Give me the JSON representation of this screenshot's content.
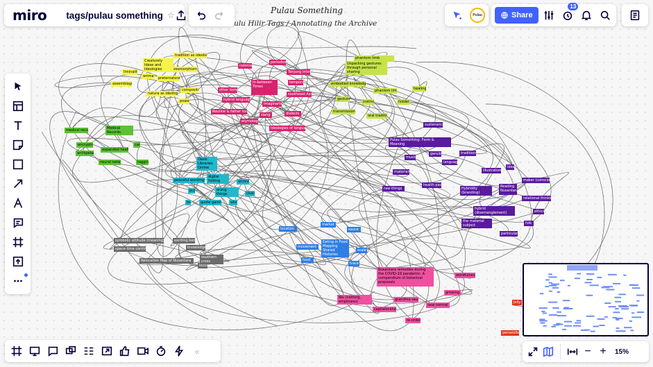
{
  "app": {
    "logo": "miro"
  },
  "header": {
    "board_title": "tags/pulau something",
    "share_label": "Share",
    "notification_count": "13",
    "avatar_text": "Pulau"
  },
  "canvas_titles": {
    "title_1": "Pulau Something",
    "title_2": "Pulu Hilir Tags / Annotating the Archive"
  },
  "notes": [
    {
      "text": "tradition as ideology",
      "bg": "#f5f34a",
      "fg": "#000"
    },
    {
      "text": "Creaturely Ideas and Ideologies",
      "bg": "#f5f34a",
      "fg": "#000"
    },
    {
      "text": "zoomorphism",
      "bg": "#f5f34a",
      "fg": "#000"
    },
    {
      "text": "liminality",
      "bg": "#f5f34a",
      "fg": "#000"
    },
    {
      "text": "animal",
      "bg": "#f5f34a",
      "fg": "#000"
    },
    {
      "text": "preternatural",
      "bg": "#f5f34a",
      "fg": "#000"
    },
    {
      "text": "assemblage",
      "bg": "#f5f34a",
      "fg": "#000"
    },
    {
      "text": "natura as ideology",
      "bg": "#f5f34a",
      "fg": "#000"
    },
    {
      "text": "composite",
      "bg": "#f5f34a",
      "fg": "#000"
    },
    {
      "text": "power",
      "bg": "#f5f34a",
      "fg": "#000"
    },
    {
      "text": "phantom limb",
      "bg": "#c6e34a",
      "fg": "#000"
    },
    {
      "text": "Unpacking gestures through personal sharing",
      "bg": "#c6e34a",
      "fg": "#000"
    },
    {
      "text": "embodied knowledge(s)",
      "bg": "#c6e34a",
      "fg": "#000"
    },
    {
      "text": "phantom limbs",
      "bg": "#c6e34a",
      "fg": "#000"
    },
    {
      "text": "healing",
      "bg": "#c6e34a",
      "fg": "#000"
    },
    {
      "text": "gestures",
      "bg": "#c6e34a",
      "fg": "#000"
    },
    {
      "text": "instinct",
      "bg": "#c6e34a",
      "fg": "#000"
    },
    {
      "text": "hidden",
      "bg": "#c6e34a",
      "fg": "#000"
    },
    {
      "text": "transmission",
      "bg": "#c6e34a",
      "fg": "#000"
    },
    {
      "text": "oral traditions",
      "bg": "#c6e34a",
      "fg": "#000"
    },
    {
      "text": "In-between Times",
      "bg": "#d6246e",
      "fg": "#fff"
    },
    {
      "text": "colonial",
      "bg": "#d6246e",
      "fg": "#fff"
    },
    {
      "text": "periodization",
      "bg": "#d6246e",
      "fg": "#fff"
    },
    {
      "text": "Tanjung intentions",
      "bg": "#d6246e",
      "fg": "#fff"
    },
    {
      "text": "temporal",
      "bg": "#d6246e",
      "fg": "#fff"
    },
    {
      "text": "other temporality",
      "bg": "#d6246e",
      "fg": "#fff"
    },
    {
      "text": "southeast Asia",
      "bg": "#d6246e",
      "fg": "#fff"
    },
    {
      "text": "hybrid language",
      "bg": "#d6246e",
      "fg": "#fff"
    },
    {
      "text": "imaginaries",
      "bg": "#d6246e",
      "fg": "#fff"
    },
    {
      "text": "Routine & father tongue",
      "bg": "#d6246e",
      "fg": "#fff"
    },
    {
      "text": "etymology",
      "bg": "#d6246e",
      "fg": "#fff"
    },
    {
      "text": "slang",
      "bg": "#d6246e",
      "fg": "#fff"
    },
    {
      "text": "dialects",
      "bg": "#d6246e",
      "fg": "#fff"
    },
    {
      "text": "Ideologies of language",
      "bg": "#d6246e",
      "fg": "#fff"
    },
    {
      "text": "Medical Records",
      "bg": "#5cc234",
      "fg": "#000"
    },
    {
      "text": "medical record",
      "bg": "#5cc234",
      "fg": "#000"
    },
    {
      "text": "encryption",
      "bg": "#5cc234",
      "fg": "#000"
    },
    {
      "text": "care",
      "bg": "#5cc234",
      "fg": "#000"
    },
    {
      "text": "archipelago",
      "bg": "#5cc234",
      "fg": "#000"
    },
    {
      "text": "expanded health",
      "bg": "#5cc234",
      "fg": "#000"
    },
    {
      "text": "neural network",
      "bg": "#5cc234",
      "fg": "#000"
    },
    {
      "text": "tagging",
      "bg": "#5cc234",
      "fg": "#000"
    },
    {
      "text": "Oasis Libraries Online",
      "bg": "#21b8cc",
      "fg": "#000"
    },
    {
      "text": "digital folding",
      "bg": "#21b8cc",
      "fg": "#000"
    },
    {
      "text": "peaceful wordings",
      "bg": "#21b8cc",
      "fg": "#000"
    },
    {
      "text": "orang things",
      "bg": "#21b8cc",
      "fg": "#000"
    },
    {
      "text": "archive",
      "bg": "#21b8cc",
      "fg": "#000"
    },
    {
      "text": "pcg",
      "bg": "#21b8cc",
      "fg": "#000"
    },
    {
      "text": "clues",
      "bg": "#21b8cc",
      "fg": "#000"
    },
    {
      "text": "bs",
      "bg": "#21b8cc",
      "fg": "#000"
    },
    {
      "text": "quote gaming",
      "bg": "#21b8cc",
      "fg": "#000"
    },
    {
      "text": "site",
      "bg": "#21b8cc",
      "fg": "#000"
    },
    {
      "text": "Pulau Something: Form & Meaning",
      "bg": "#5a1a9e",
      "fg": "#fff"
    },
    {
      "text": "sustenance",
      "bg": "#5a1a9e",
      "fg": "#fff"
    },
    {
      "text": "music",
      "bg": "#5a1a9e",
      "fg": "#fff"
    },
    {
      "text": "garuda",
      "bg": "#5a1a9e",
      "fg": "#fff"
    },
    {
      "text": "traditions",
      "bg": "#5a1a9e",
      "fg": "#fff"
    },
    {
      "text": "language",
      "bg": "#5a1a9e",
      "fg": "#fff"
    },
    {
      "text": "materials",
      "bg": "#5a1a9e",
      "fg": "#fff"
    },
    {
      "text": "illustrations",
      "bg": "#5a1a9e",
      "fg": "#fff"
    },
    {
      "text": "ideas",
      "bg": "#5a1a9e",
      "fg": "#fff"
    },
    {
      "text": "maker (consciousness)",
      "bg": "#5a1a9e",
      "fg": "#fff"
    },
    {
      "text": "raw things",
      "bg": "#5a1a9e",
      "fg": "#fff"
    },
    {
      "text": "health pact",
      "bg": "#5a1a9e",
      "fg": "#fff"
    },
    {
      "text": "Hybridity (branding)",
      "bg": "#5a1a9e",
      "fg": "#fff"
    },
    {
      "text": "Reading Nusantara",
      "bg": "#5a1a9e",
      "fg": "#fff"
    },
    {
      "text": "relational thinking",
      "bg": "#5a1a9e",
      "fg": "#fff"
    },
    {
      "text": "hybrid (disentanglement)",
      "bg": "#5a1a9e",
      "fg": "#fff"
    },
    {
      "text": "ethics",
      "bg": "#5a1a9e",
      "fg": "#fff"
    },
    {
      "text": "the material subject",
      "bg": "#5a1a9e",
      "fg": "#fff"
    },
    {
      "text": "folk",
      "bg": "#5a1a9e",
      "fg": "#fff"
    },
    {
      "text": "particularism",
      "bg": "#5a1a9e",
      "fg": "#fff"
    },
    {
      "text": "symbolic attitude (meaning)",
      "bg": "#6b6b6b",
      "fg": "#fff"
    },
    {
      "text": "exciting bent",
      "bg": "#6b6b6b",
      "fg": "#fff"
    },
    {
      "text": "space-time continuum",
      "bg": "#6b6b6b",
      "fg": "#fff"
    },
    {
      "text": "knowledge",
      "bg": "#6b6b6b",
      "fg": "#fff"
    },
    {
      "text": "Relocation Map of Nusantara",
      "bg": "#6b6b6b",
      "fg": "#fff"
    },
    {
      "text": "southern cross",
      "bg": "#6b6b6b",
      "fg": "#fff"
    },
    {
      "text": "locus",
      "bg": "#6b6b6b",
      "fg": "#fff"
    },
    {
      "text": "location",
      "bg": "#2f7ee6",
      "fg": "#fff"
    },
    {
      "text": "market",
      "bg": "#2f7ee6",
      "fg": "#fff"
    },
    {
      "text": "sauce",
      "bg": "#2f7ee6",
      "fg": "#fff"
    },
    {
      "text": "Eating in Food Mapping Shared Histories",
      "bg": "#2f7ee6",
      "fg": "#fff"
    },
    {
      "text": "movement",
      "bg": "#2f7ee6",
      "fg": "#fff"
    },
    {
      "text": "scale",
      "bg": "#2f7ee6",
      "fg": "#fff"
    },
    {
      "text": "food",
      "bg": "#2f7ee6",
      "fg": "#fff"
    },
    {
      "text": "trace",
      "bg": "#2f7ee6",
      "fg": "#fff"
    },
    {
      "text": "Nusantara remedies during the COVID-19 pandemic: A compendium of botanical proposals",
      "bg": "#f04fa0",
      "fg": "#000"
    },
    {
      "text": "wordfulness",
      "bg": "#f04fa0",
      "fg": "#000"
    },
    {
      "text": "Wu (nothing, emptiness)",
      "bg": "#f04fa0",
      "fg": "#000"
    },
    {
      "text": "grandma says",
      "bg": "#f04fa0",
      "fg": "#000"
    },
    {
      "text": "growing",
      "bg": "#f04fa0",
      "fg": "#000"
    },
    {
      "text": "new normal",
      "bg": "#f04fa0",
      "fg": "#000"
    },
    {
      "text": "capitalocene",
      "bg": "#f04fa0",
      "fg": "#000"
    },
    {
      "text": "re-order",
      "bg": "#f04fa0",
      "fg": "#000"
    },
    {
      "text": "jelly",
      "bg": "#e8341c",
      "fg": "#fff"
    },
    {
      "text": "personification",
      "bg": "#e8341c",
      "fg": "#fff"
    }
  ],
  "left_toolbar": {
    "tools": [
      "select-tool",
      "templates-tool",
      "text-tool",
      "sticky-note-tool",
      "shape-tool",
      "connection-line-tool",
      "pen-tool",
      "comment-tool",
      "frame-tool",
      "upload-tool",
      "more-tools"
    ]
  },
  "bottom_toolbar": {
    "collapse_label": "«"
  },
  "zoom": {
    "level": "15%"
  }
}
